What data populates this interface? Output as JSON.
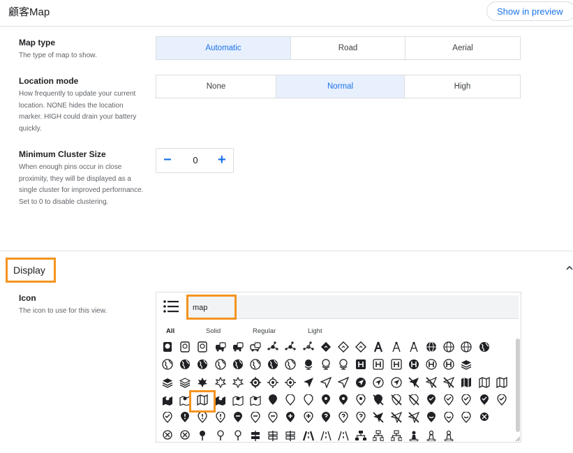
{
  "app": {
    "title": "顧客Map",
    "preview_label": "Show in preview"
  },
  "map_type": {
    "title": "Map type",
    "description": "The type of map to show.",
    "options": [
      "Automatic",
      "Road",
      "Aerial"
    ],
    "selected": "Automatic"
  },
  "location_mode": {
    "title": "Location mode",
    "description": "How frequently to update your current location. NONE hides the location marker. HIGH could drain your battery quickly.",
    "options": [
      "None",
      "Normal",
      "High"
    ],
    "selected": "Normal"
  },
  "cluster": {
    "title": "Minimum Cluster Size",
    "description": "When enough pins occur in close proximity, they will be displayed as a single cluster for improved performance. Set to 0 to disable clustering.",
    "value": "0",
    "minus": "−",
    "plus": "+"
  },
  "display": {
    "section_title": "Display",
    "icon": {
      "title": "Icon",
      "description": "The icon to use for this view.",
      "search_value": "map",
      "tabs": [
        "All",
        "Solid",
        "Regular",
        "Light"
      ],
      "active_tab": "All",
      "selected_icon": "map-folded-icon"
    }
  },
  "colors": {
    "accent": "#1a73e8",
    "highlight": "#f5941f",
    "selected_bg": "#e8f0fe"
  }
}
